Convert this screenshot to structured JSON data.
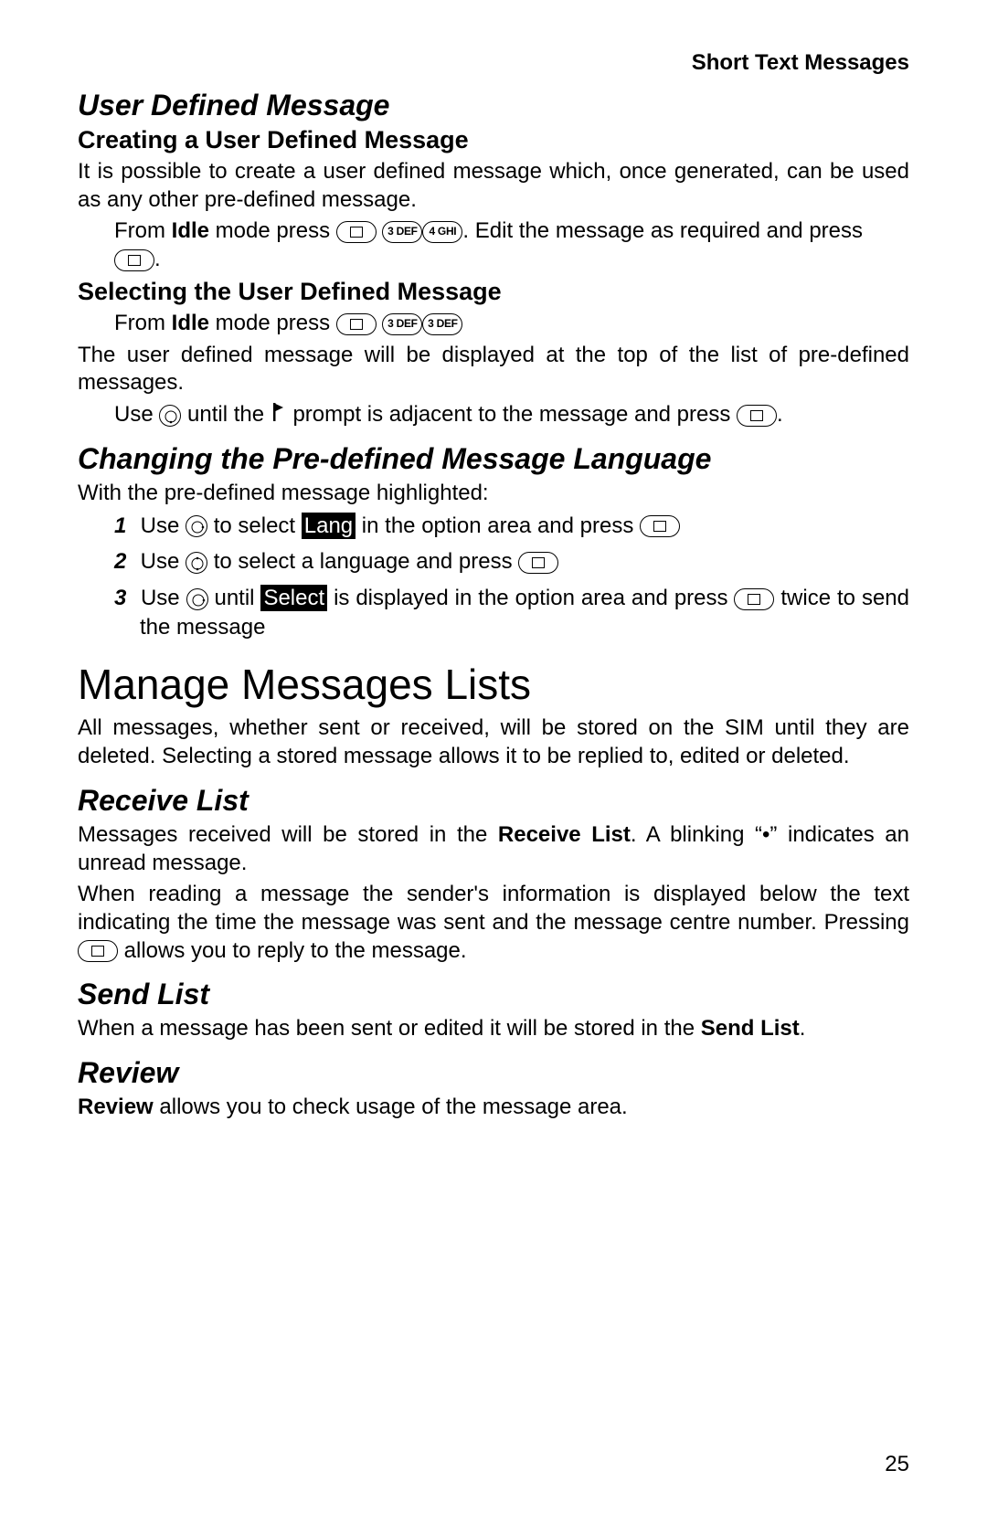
{
  "header": {
    "running": "Short Text Messages"
  },
  "sections": {
    "udm": {
      "title": "User Defined Message",
      "create": {
        "heading": "Creating a User Defined Message",
        "p1": "It is possible to create a user defined message which, once generated, can be used as any other pre-defined message.",
        "step_prefix": "From ",
        "step_idle": "Idle",
        "step_mid": " mode press ",
        "step_suffix": ". Edit the message as required and press ",
        "step_end": "."
      },
      "select": {
        "heading": "Selecting the User Defined Message",
        "step_prefix": "From ",
        "step_idle": "Idle",
        "step_mid": " mode press ",
        "p2": "The user defined message will be displayed at the top of the list of pre-defined messages.",
        "use_prefix": "Use ",
        "use_mid1": " until the",
        "use_mid2": " prompt is adjacent to the message and press ",
        "use_end": "."
      }
    },
    "lang": {
      "title": "Changing the Pre-defined Message Language",
      "intro": "With the pre-defined message highlighted:",
      "items": {
        "n1": "1",
        "n2": "2",
        "n3": "3",
        "i1a": "Use ",
        "i1b": " to select ",
        "i1_hl": "Lang",
        "i1c": " in the option area and press ",
        "i2a": "Use ",
        "i2b": " to select a language and press ",
        "i3a": "Use ",
        "i3b": " until ",
        "i3_hl": "Select",
        "i3c": " is displayed in the option area and press ",
        "i3d": " twice to send the message"
      }
    },
    "manage": {
      "h1": "Manage Messages Lists",
      "p1": "All messages, whether sent or received, will be stored on the SIM until they are deleted. Selecting a stored message allows it to be replied to, edited or deleted.",
      "receive": {
        "title": "Receive List",
        "p1a": "Messages received will be stored in the ",
        "p1b": "Receive List",
        "p1c": ". A blinking “•” indicates an unread message.",
        "p2a": "When reading a message the sender's information is displayed below the text indicating the time the message was sent and the message centre number. Pressing ",
        "p2b": " allows you to reply to the message."
      },
      "send": {
        "title": "Send List",
        "p_a": "When a message has been sent or edited it will be stored in the ",
        "p_b": "Send List",
        "p_c": "."
      },
      "review": {
        "title": "Review",
        "p_a": "Review",
        "p_b": " allows you to check usage of the message area."
      }
    }
  },
  "keys": {
    "three": "3 DEF",
    "four": "4 GHI"
  },
  "page_number": "25"
}
